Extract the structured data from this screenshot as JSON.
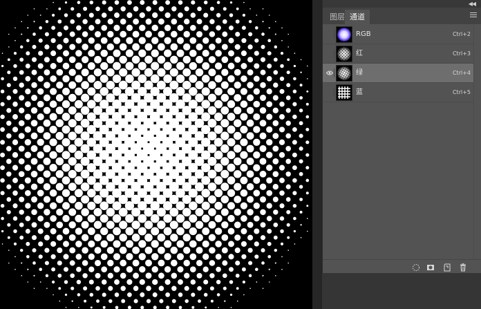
{
  "panel": {
    "tabs": [
      {
        "label": "图层",
        "active": false
      },
      {
        "label": "通道",
        "active": true
      }
    ],
    "collapse_icon": "double-chevron-left-icon",
    "menu_icon": "panel-menu-icon"
  },
  "channels": [
    {
      "name": "RGB",
      "shortcut": "Ctrl+2",
      "visible": false,
      "selected": false
    },
    {
      "name": "红",
      "shortcut": "Ctrl+3",
      "visible": false,
      "selected": false
    },
    {
      "name": "绿",
      "shortcut": "Ctrl+4",
      "visible": true,
      "selected": true
    },
    {
      "name": "蓝",
      "shortcut": "Ctrl+5",
      "visible": false,
      "selected": false
    }
  ],
  "footer_icons": [
    "dotted-circle-selection-icon",
    "save-selection-as-channel-icon",
    "new-channel-icon",
    "trash-icon"
  ],
  "colors": {
    "panel_bg": "#535353",
    "selected_row": "#6e6e6e",
    "canvas_bg": "#000000",
    "dots": "#ffffff"
  }
}
